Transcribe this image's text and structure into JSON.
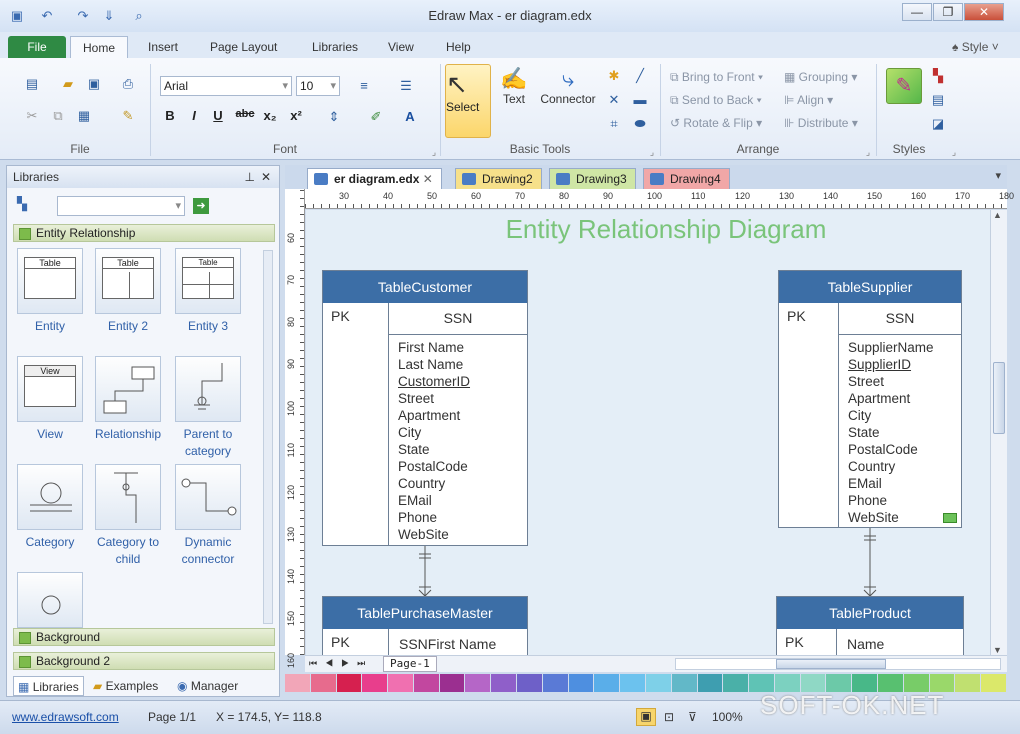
{
  "window": {
    "title": "Edraw Max - er diagram.edx"
  },
  "ribbon_tabs": [
    "File",
    "Home",
    "Insert",
    "Page Layout",
    "Libraries",
    "View",
    "Help"
  ],
  "style_menu": "Style",
  "font": {
    "name": "Arial",
    "size": "10"
  },
  "format_buttons": [
    "B",
    "I",
    "U",
    "abc",
    "x₂",
    "x²"
  ],
  "groups": {
    "file": "File",
    "font": "Font",
    "basic_tools": "Basic Tools",
    "arrange": "Arrange",
    "styles": "Styles"
  },
  "tools": {
    "select": "Select",
    "text": "Text",
    "connector": "Connector"
  },
  "arrange": {
    "bring_front": "Bring to Front",
    "send_back": "Send to Back",
    "rotate_flip": "Rotate & Flip",
    "grouping": "Grouping",
    "align": "Align",
    "distribute": "Distribute"
  },
  "libraries": {
    "header": "Libraries",
    "category": "Entity Relationship",
    "shapes": [
      {
        "label": "Entity",
        "thumb": "Table"
      },
      {
        "label": "Entity 2",
        "thumb": "Table"
      },
      {
        "label": "Entity 3",
        "thumb": "Table"
      },
      {
        "label": "View",
        "thumb": "View"
      },
      {
        "label": "Relationship",
        "thumb": ""
      },
      {
        "label": "Parent to category",
        "thumb": ""
      },
      {
        "label": "Category",
        "thumb": ""
      },
      {
        "label": "Category to child",
        "thumb": ""
      },
      {
        "label": "Dynamic connector",
        "thumb": ""
      }
    ],
    "bg1": "Background",
    "bg2": "Background 2",
    "bottom_tabs": [
      "Libraries",
      "Examples",
      "Manager"
    ]
  },
  "doc_tabs": [
    {
      "label": "er diagram.edx",
      "color": "#ffffff"
    },
    {
      "label": "Drawing2",
      "color": "#f6e08a"
    },
    {
      "label": "Drawing3",
      "color": "#cfe6a5"
    },
    {
      "label": "Drawing4",
      "color": "#f1a7a7"
    }
  ],
  "ruler_top": [
    "30",
    "40",
    "50",
    "60",
    "70",
    "80",
    "90",
    "100",
    "110",
    "120",
    "130",
    "140",
    "150",
    "160",
    "170",
    "180"
  ],
  "ruler_left": [
    "60",
    "70",
    "80",
    "90",
    "100",
    "110",
    "120",
    "130",
    "140",
    "150",
    "160"
  ],
  "diagram": {
    "title": "Entity Relationship Diagram",
    "entities": [
      {
        "name": "TableCustomer",
        "pk": "PK",
        "key": "SSN",
        "fields": [
          "First Name",
          "Last Name",
          "CustomerID",
          "Street",
          "Apartment",
          "City",
          "State",
          "PostalCode",
          "Country",
          "EMail",
          "Phone",
          "WebSite"
        ]
      },
      {
        "name": "TableSupplier",
        "pk": "PK",
        "key": "SSN",
        "fields": [
          "SupplierName",
          "SupplierID",
          "Street",
          "Apartment",
          "City",
          "State",
          "PostalCode",
          "Country",
          "EMail",
          "Phone",
          "WebSite"
        ]
      },
      {
        "name": "TablePurchaseMaster",
        "pk": "PK",
        "key": "SSNFirst Name"
      },
      {
        "name": "TableProduct",
        "pk": "PK",
        "key": "Name"
      }
    ]
  },
  "page_tab": "Page-1",
  "palette": [
    "#f2a6b8",
    "#e76b8d",
    "#d6204f",
    "#e83e8c",
    "#f070b0",
    "#c2479f",
    "#9b2f90",
    "#b566c7",
    "#8f5fc9",
    "#6e60c8",
    "#5a7ad6",
    "#4e8fe0",
    "#5aaee9",
    "#6cc2ee",
    "#7ed0e8",
    "#62b8c8",
    "#3e9eb0",
    "#4ab0a8",
    "#5fc3b5",
    "#7cd1c0",
    "#8fd8c5",
    "#6cc9a8",
    "#48b888",
    "#58c070",
    "#78cc68",
    "#9ad86a",
    "#c0e070",
    "#dbe86a"
  ],
  "status": {
    "url": "www.edrawsoft.com",
    "page": "Page 1/1",
    "coords": "X = 174.5, Y= 118.8",
    "zoom": "100%"
  },
  "watermark": "SOFT-OK.NET"
}
